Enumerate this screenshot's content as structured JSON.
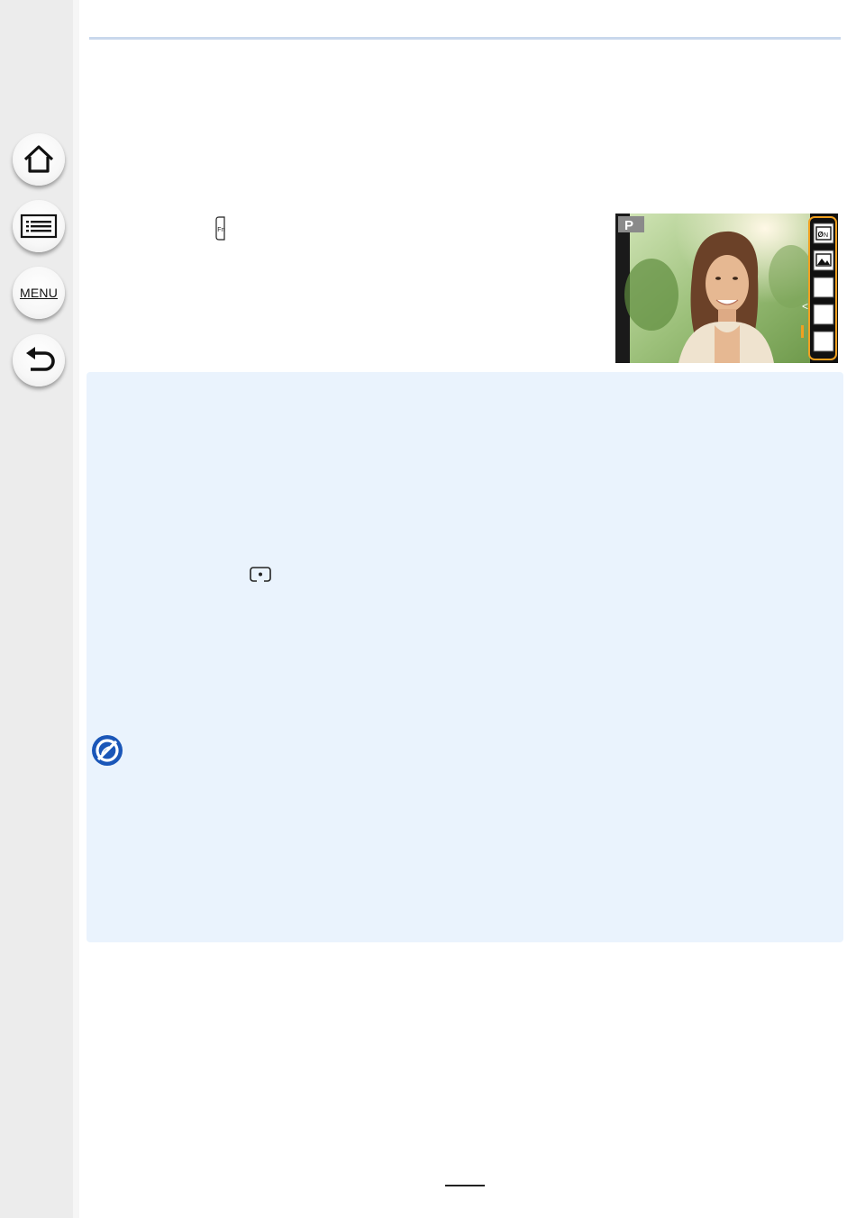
{
  "sidebar": {
    "menu_label": "MENU",
    "buttons": [
      {
        "icon": "home-icon"
      },
      {
        "icon": "contents-list-icon"
      },
      {
        "icon": "menu-icon"
      },
      {
        "icon": "back-icon"
      }
    ]
  },
  "preview": {
    "mode_label": "P",
    "side_icons": [
      "filter-effect-icon",
      "picture-icon",
      "blank",
      "blank",
      "blank"
    ],
    "highlight_color": "#f0a020"
  },
  "colors": {
    "sidebar_bg": "#ececec",
    "rule": "#c9d8ec",
    "panel_bg": "#eaf3fd",
    "prohibit_blue": "#1a56b8"
  }
}
